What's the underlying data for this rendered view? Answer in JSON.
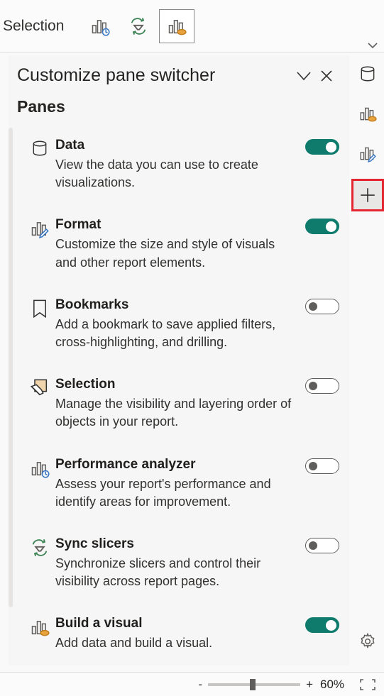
{
  "toolbar": {
    "label": "Selection"
  },
  "panel": {
    "title": "Customize pane switcher",
    "subtitle": "Panes",
    "items": [
      {
        "title": "Data",
        "desc": "View the data you can use to create visualizations.",
        "on": true
      },
      {
        "title": "Format",
        "desc": "Customize the size and style of visuals and other report elements.",
        "on": true
      },
      {
        "title": "Bookmarks",
        "desc": "Add a bookmark to save applied filters, cross-highlighting, and drilling.",
        "on": false
      },
      {
        "title": "Selection",
        "desc": "Manage the visibility and layering order of objects in your report.",
        "on": false
      },
      {
        "title": "Performance analyzer",
        "desc": "Assess your report's performance and identify areas for improvement.",
        "on": false
      },
      {
        "title": "Sync slicers",
        "desc": "Synchronize slicers and control their visibility across report pages.",
        "on": false
      },
      {
        "title": "Build a visual",
        "desc": "Add data and build a visual.",
        "on": true
      }
    ]
  },
  "status": {
    "minus": "-",
    "plus": "+",
    "zoom": "60%"
  }
}
